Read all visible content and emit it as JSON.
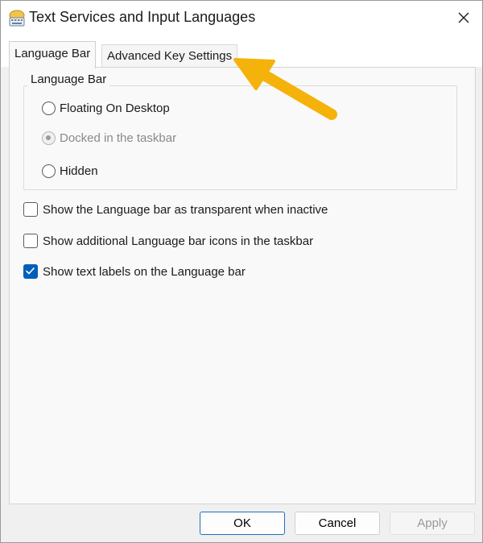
{
  "window": {
    "title": "Text Services and Input Languages",
    "icon": "keyboard-language-icon",
    "close_icon": "close-icon"
  },
  "tabs": [
    {
      "label": "Language Bar",
      "active": true
    },
    {
      "label": "Advanced Key Settings",
      "active": false
    }
  ],
  "language_bar_group": {
    "legend": "Language Bar",
    "options": [
      {
        "label": "Floating On Desktop",
        "selected": false,
        "disabled": false
      },
      {
        "label": "Docked in the taskbar",
        "selected": true,
        "disabled": true
      },
      {
        "label": "Hidden",
        "selected": false,
        "disabled": false
      }
    ]
  },
  "checkboxes": [
    {
      "label": "Show the Language bar as transparent when inactive",
      "checked": false
    },
    {
      "label": "Show additional Language bar icons in the taskbar",
      "checked": false
    },
    {
      "label": "Show text labels on the Language bar",
      "checked": true
    }
  ],
  "buttons": {
    "ok": "OK",
    "cancel": "Cancel",
    "apply": "Apply"
  },
  "colors": {
    "accent": "#005fb8",
    "annotation_arrow": "#f5b20a"
  }
}
